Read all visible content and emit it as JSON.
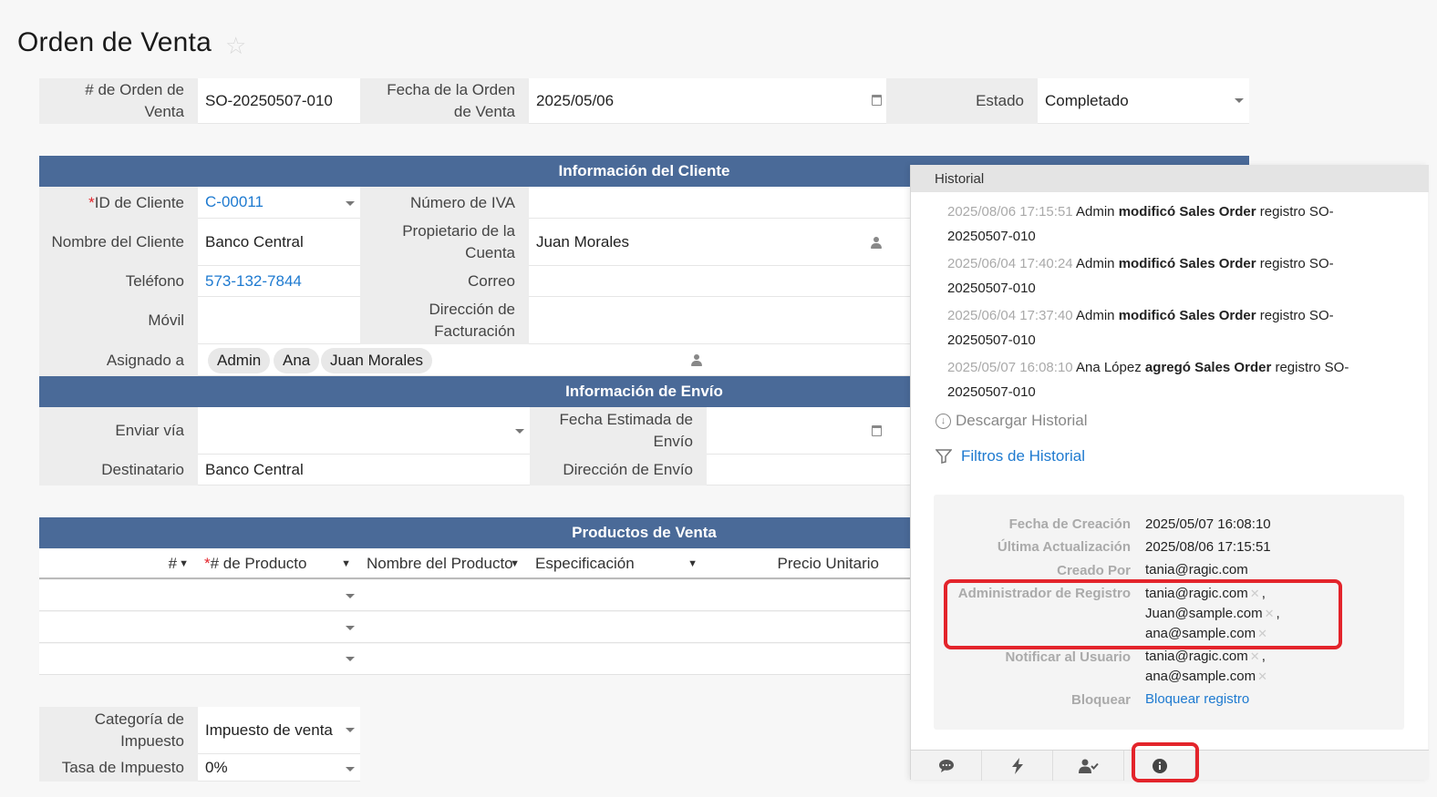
{
  "page": {
    "title": "Orden de Venta"
  },
  "header_fields": {
    "order_no_label": "# de Orden de Venta",
    "order_no": "SO-20250507-010",
    "order_date_label": "Fecha de la Orden de Venta",
    "order_date": "2025/05/06",
    "status_label": "Estado",
    "status": "Completado"
  },
  "customer_section": {
    "title": "Información del Cliente",
    "customer_id_label": "ID de Cliente",
    "customer_id": "C-00011",
    "vat_label": "Número de IVA",
    "vat": "",
    "customer_name_label": "Nombre del Cliente",
    "customer_name": "Banco Central",
    "owner_label": "Propietario de la Cuenta",
    "owner": "Juan Morales",
    "phone_label": "Teléfono",
    "phone": "573-132-7844",
    "email_label": "Correo",
    "email": "",
    "mobile_label": "Móvil",
    "mobile": "",
    "billing_label": "Dirección de Facturación",
    "billing": "",
    "assigned_label": "Asignado a",
    "assigned": [
      "Admin",
      "Ana",
      "Juan Morales"
    ]
  },
  "shipping_section": {
    "title": "Información de Envío",
    "ship_via_label": "Enviar vía",
    "ship_via": "",
    "est_date_label": "Fecha Estimada de Envío",
    "est_date": "",
    "recipient_label": "Destinatario",
    "recipient": "Banco Central",
    "ship_addr_label": "Dirección de Envío",
    "ship_addr": ""
  },
  "products_section": {
    "title": "Productos de Venta",
    "columns": [
      "#",
      "# de Producto",
      "Nombre del Producto",
      "Especificación",
      "Precio Unitario"
    ]
  },
  "tax": {
    "category_label": "Categoría de Impuesto",
    "category": "Impuesto de venta",
    "rate_label": "Tasa de Impuesto",
    "rate": "0%"
  },
  "history_panel": {
    "title": "Historial",
    "entries": [
      {
        "ts": "2025/08/06 17:15:51",
        "user": "Admin",
        "action": "modificó Sales Order",
        "rest": "registro SO-",
        "rest2": "20250507-010"
      },
      {
        "ts": "2025/06/04 17:40:24",
        "user": "Admin",
        "action": "modificó Sales Order",
        "rest": "registro SO-",
        "rest2": "20250507-010"
      },
      {
        "ts": "2025/06/04 17:37:40",
        "user": "Admin",
        "action": "modificó Sales Order",
        "rest": "registro SO-",
        "rest2": "20250507-010"
      },
      {
        "ts": "2025/05/07 16:08:10",
        "user": "Ana López",
        "action": "agregó Sales Order",
        "rest": "registro SO-",
        "rest2": "20250507-010"
      }
    ],
    "download_label": "Descargar Historial",
    "filters_label": "Filtros de Historial",
    "meta": {
      "created_label": "Fecha de Creación",
      "created": "2025/05/07 16:08:10",
      "updated_label": "Última Actualización",
      "updated": "2025/08/06 17:15:51",
      "created_by_label": "Creado Por",
      "created_by": "tania@ragic.com",
      "admin_label": "Administrador de Registro",
      "admins": [
        "tania@ragic.com",
        "Juan@sample.com",
        "ana@sample.com"
      ],
      "notify_label": "Notificar al Usuario",
      "notify": [
        "tania@ragic.com",
        "ana@sample.com"
      ],
      "lock_label": "Bloquear",
      "lock_link": "Bloquear registro"
    }
  },
  "colors": {
    "section_bar": "#4a6a98",
    "link": "#1e7ad0",
    "highlight": "#e3242b"
  }
}
